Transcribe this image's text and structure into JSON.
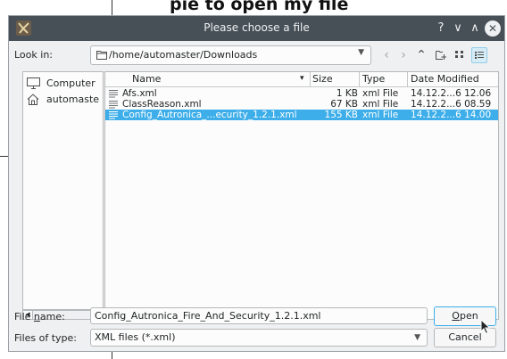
{
  "backdrop": {
    "title": "pie to open my file"
  },
  "dialog": {
    "title": "Please choose a file",
    "titlebar_buttons": {
      "help": "?",
      "minimize": "∨",
      "maximize": "∧",
      "close": "✕"
    }
  },
  "lookin": {
    "label": "Look in:",
    "path": "/home/automaster/Downloads"
  },
  "sidebar": {
    "items": [
      {
        "label": "Computer",
        "icon": "computer-icon"
      },
      {
        "label": "automaste",
        "icon": "home-icon"
      }
    ]
  },
  "filelist": {
    "columns": [
      "Name",
      "Size",
      "Type",
      "Date Modified"
    ],
    "sort_indicator": "▾",
    "rows": [
      {
        "name": "Afs.xml",
        "size": "1 KB",
        "type": "xml File",
        "modified": "14.12.2...6 12.06",
        "selected": false
      },
      {
        "name": "ClassReason.xml",
        "size": "67 KB",
        "type": "xml File",
        "modified": "14.12.2...6 08.59",
        "selected": false
      },
      {
        "name": "Config_Autronica_...ecurity_1.2.1.xml",
        "size": "155 KB",
        "type": "xml File",
        "modified": "14.12.2...6 14.00",
        "selected": true
      }
    ]
  },
  "filename": {
    "label_prefix": "File ",
    "label_mnemonic": "n",
    "label_suffix": "ame:",
    "value": "Config_Autronica_Fire_And_Security_1.2.1.xml"
  },
  "filetype": {
    "label": "Files of type:",
    "value": "XML files (*.xml)"
  },
  "buttons": {
    "open_mnemonic": "O",
    "open_rest": "pen",
    "cancel": "Cancel"
  },
  "colors": {
    "selection": "#3daee9",
    "titlebar": "#475057",
    "window": "#eff0f1"
  }
}
